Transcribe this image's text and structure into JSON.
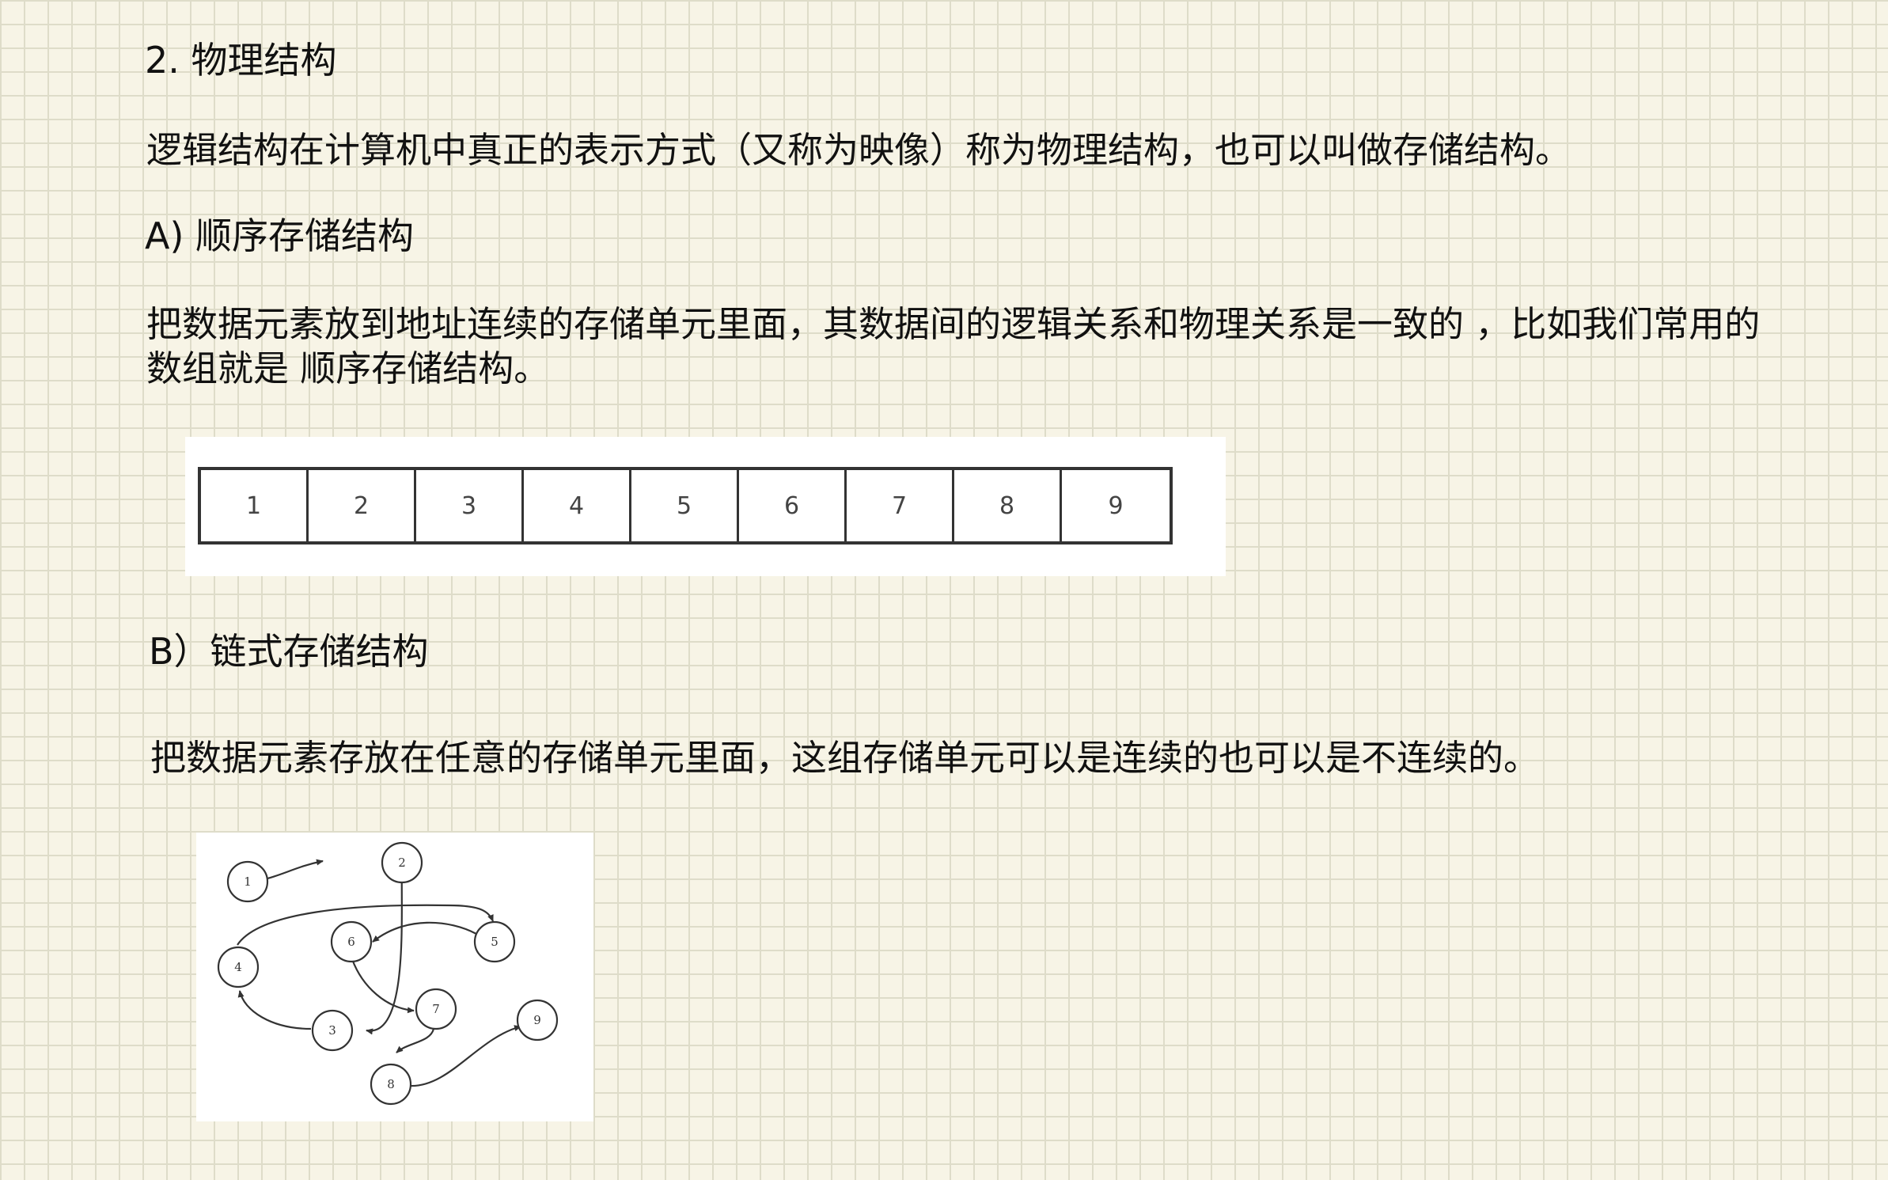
{
  "section": {
    "title": "2. 物理结构",
    "intro": "逻辑结构在计算机中真正的表示方式（又称为映像）称为物理结构，也可以叫做存储结构。"
  },
  "sequential": {
    "heading": "A) 顺序存储结构",
    "line1": "把数据元素放到地址连续的存储单元里面，其数据间的逻辑关系和物理关系是一致的 ，比如我们常用的",
    "line2": "数组就是 顺序存储结构。",
    "array_cells": [
      "1",
      "2",
      "3",
      "4",
      "5",
      "6",
      "7",
      "8",
      "9"
    ]
  },
  "linked": {
    "heading": "B）链式存储结构",
    "description": "把数据元素存放在任意的存储单元里面，这组存储单元可以是连续的也可以是不连续的。",
    "nodes": [
      "1",
      "2",
      "3",
      "4",
      "5",
      "6",
      "7",
      "8",
      "9"
    ]
  }
}
